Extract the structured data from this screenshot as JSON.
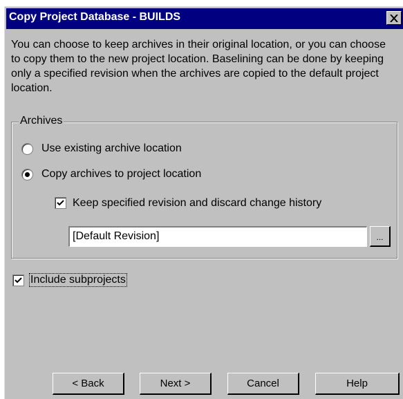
{
  "window": {
    "title": "Copy Project Database - BUILDS",
    "close_glyph": "✕"
  },
  "intro_text": "You can choose to keep archives in their original location, or you can choose to copy them to the new project location.  Baselining can be done by keeping only a specified revision when the archives are copied to the default project location.",
  "archives": {
    "group_label": "Archives",
    "use_existing_label": "Use existing archive location",
    "use_existing_selected": false,
    "copy_label": "Copy archives to project location",
    "copy_selected": true,
    "keep_revision_label": "Keep specified revision and discard change history",
    "keep_revision_checked": true,
    "revision_value": "[Default Revision]",
    "browse_label": "..."
  },
  "include_subprojects": {
    "label": "Include subprojects",
    "checked": true
  },
  "buttons": {
    "back": "< Back",
    "next": "Next >",
    "cancel": "Cancel",
    "help": "Help"
  }
}
